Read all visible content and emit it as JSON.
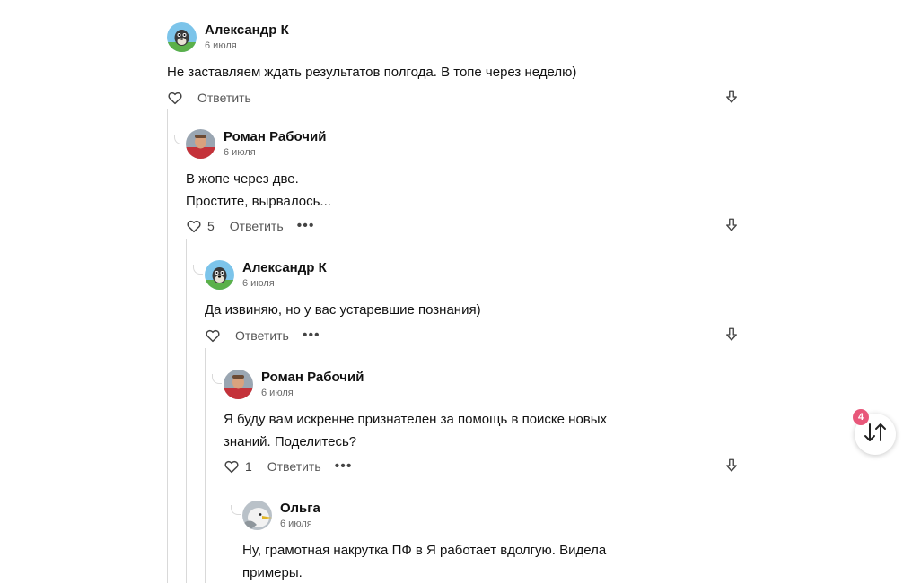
{
  "colors": {
    "accent_badge": "#e8577a",
    "thread_line": "#d9d9d9",
    "meta_text": "#6b6b6b"
  },
  "comments": [
    {
      "author": "Александр К",
      "date": "6 июля",
      "lines": [
        "Не заставляем ждать результатов полгода. В топе через неделю)"
      ],
      "likes": "",
      "reply_label": "Ответить",
      "avatar": "cartoon-animal"
    },
    {
      "author": "Роман Рабочий",
      "date": "6 июля",
      "lines": [
        "В жопе через две.",
        "Простите, вырвалось..."
      ],
      "likes": "5",
      "reply_label": "Ответить",
      "avatar": "person-photo"
    },
    {
      "author": "Александр К",
      "date": "6 июля",
      "lines": [
        "Да извиняю, но у вас устаревшие познания)"
      ],
      "likes": "",
      "reply_label": "Ответить",
      "avatar": "cartoon-animal"
    },
    {
      "author": "Роман Рабочий",
      "date": "6 июля",
      "lines": [
        "Я буду вам искренне признателен за помощь в поиске новых",
        "знаний. Поделитесь?"
      ],
      "likes": "1",
      "reply_label": "Ответить",
      "avatar": "person-photo"
    },
    {
      "author": "Ольга",
      "date": "6 июля",
      "lines": [
        "Ну, грамотная накрутка ПФ в Я работает вдолгую. Видела",
        "примеры."
      ],
      "likes": "",
      "reply_label": "",
      "avatar": "seagull-photo"
    }
  ],
  "fab": {
    "badge_count": "4",
    "icon": "sort-arrows-icon"
  }
}
